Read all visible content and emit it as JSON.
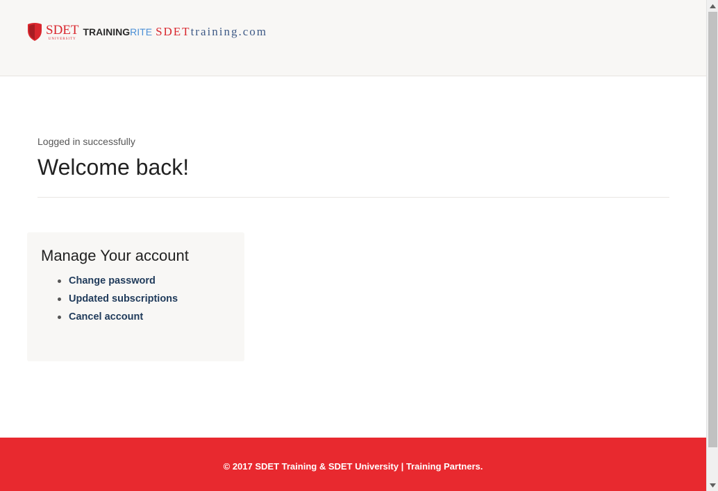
{
  "header": {
    "logo": {
      "shield_color": "#d9272e",
      "sdet": "SDET",
      "sdet_sub": "UNIVERSITY",
      "training": "TRAINING",
      "rite": "RITE",
      "domain_prefix": "SDET",
      "domain_rest": "training.com"
    }
  },
  "main": {
    "status": "Logged in successfully",
    "heading": "Welcome back!"
  },
  "account_card": {
    "title": "Manage Your account",
    "links": [
      {
        "label": "Change password"
      },
      {
        "label": "Updated subscriptions"
      },
      {
        "label": "Cancel account"
      }
    ]
  },
  "footer": {
    "text": "© 2017 SDET Training & SDET University | Training Partners."
  },
  "colors": {
    "brand_red": "#e8292f",
    "link": "#1f3a5a",
    "header_bg": "#f8f7f5"
  }
}
